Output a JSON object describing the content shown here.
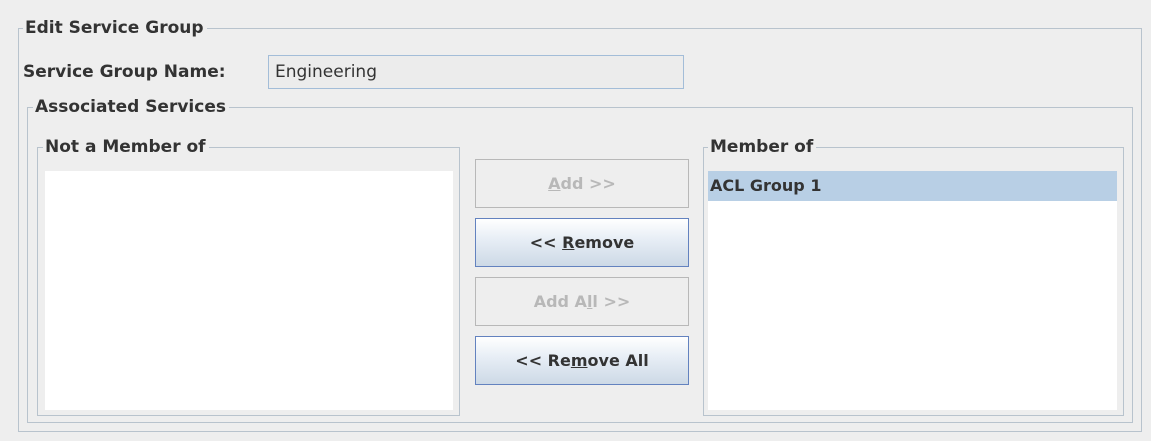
{
  "edit_group": {
    "title": "Edit Service Group",
    "name_label": "Service Group Name:",
    "name_value": "Engineering"
  },
  "associated": {
    "title": "Associated Services",
    "not_member": {
      "title": "Not a Member of",
      "items": []
    },
    "member": {
      "title": "Member of",
      "items": [
        {
          "label": "ACL Group 1",
          "selected": true
        }
      ]
    }
  },
  "buttons": {
    "add": {
      "pre": "",
      "mnemonic": "A",
      "post": "dd >>",
      "enabled": false
    },
    "remove": {
      "pre": "<< ",
      "mnemonic": "R",
      "post": "emove",
      "enabled": true
    },
    "add_all": {
      "pre": "Add A",
      "mnemonic": "l",
      "post": "l >>",
      "enabled": false
    },
    "remove_all": {
      "pre": "<< Re",
      "mnemonic": "m",
      "post": "ove All",
      "enabled": true
    }
  },
  "colors": {
    "background": "#eeeeee",
    "border": "#b8c3cd",
    "selection": "#b8cfe5",
    "button_border": "#6382bf",
    "disabled_text": "#b8b8b8"
  }
}
